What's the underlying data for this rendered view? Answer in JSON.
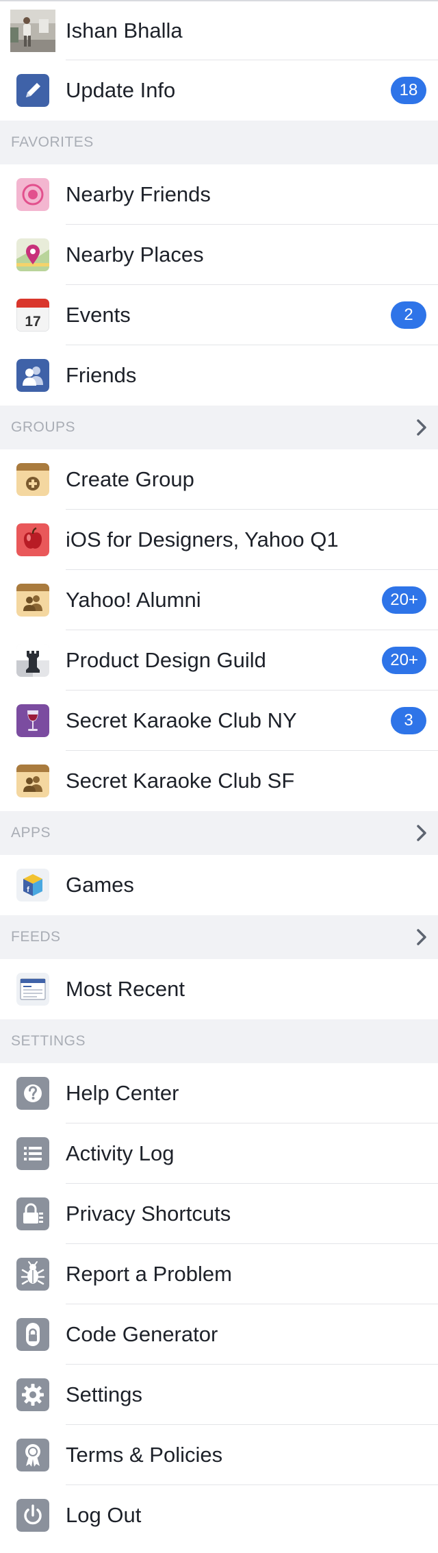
{
  "profile": {
    "name": "Ishan Bhalla"
  },
  "top_items": [
    {
      "id": "update-info",
      "label": "Update Info",
      "badge": "18",
      "icon": "pencil-icon"
    }
  ],
  "sections": {
    "favorites": {
      "title": "FAVORITES",
      "items": [
        {
          "id": "nearby-friends",
          "label": "Nearby Friends",
          "icon": "nearby-friends-icon"
        },
        {
          "id": "nearby-places",
          "label": "Nearby Places",
          "icon": "map-pin-icon"
        },
        {
          "id": "events",
          "label": "Events",
          "badge": "2",
          "icon": "calendar-icon",
          "icon_text": "17"
        },
        {
          "id": "friends",
          "label": "Friends",
          "icon": "friends-icon"
        }
      ]
    },
    "groups": {
      "title": "GROUPS",
      "items": [
        {
          "id": "create-group",
          "label": "Create Group",
          "icon": "create-group-icon"
        },
        {
          "id": "ios-for-designers",
          "label": "iOS for Designers, Yahoo Q1",
          "icon": "apple-icon"
        },
        {
          "id": "yahoo-alumni",
          "label": "Yahoo! Alumni",
          "badge": "20+",
          "icon": "group-icon"
        },
        {
          "id": "product-design-guild",
          "label": "Product Design Guild",
          "badge": "20+",
          "icon": "chess-rook-icon"
        },
        {
          "id": "secret-karaoke-ny",
          "label": "Secret Karaoke Club NY",
          "badge": "3",
          "icon": "wine-glass-icon"
        },
        {
          "id": "secret-karaoke-sf",
          "label": "Secret Karaoke Club SF",
          "icon": "group-icon"
        }
      ]
    },
    "apps": {
      "title": "APPS",
      "items": [
        {
          "id": "games",
          "label": "Games",
          "icon": "games-cube-icon"
        }
      ]
    },
    "feeds": {
      "title": "FEEDS",
      "items": [
        {
          "id": "most-recent",
          "label": "Most Recent",
          "icon": "news-feed-icon"
        }
      ]
    },
    "settings": {
      "title": "SETTINGS",
      "items": [
        {
          "id": "help-center",
          "label": "Help Center",
          "icon": "question-icon"
        },
        {
          "id": "activity-log",
          "label": "Activity Log",
          "icon": "list-icon"
        },
        {
          "id": "privacy-shortcuts",
          "label": "Privacy Shortcuts",
          "icon": "lock-icon"
        },
        {
          "id": "report-problem",
          "label": "Report a Problem",
          "icon": "bug-icon"
        },
        {
          "id": "code-generator",
          "label": "Code Generator",
          "icon": "code-generator-icon"
        },
        {
          "id": "settings",
          "label": "Settings",
          "icon": "gear-icon"
        },
        {
          "id": "terms-policies",
          "label": "Terms & Policies",
          "icon": "ribbon-icon"
        },
        {
          "id": "log-out",
          "label": "Log Out",
          "icon": "power-icon"
        }
      ]
    }
  },
  "colors": {
    "badge": "#2e74e8",
    "section_bg": "#f1f2f5",
    "section_text": "#a9adb5",
    "divider": "#e3e4e8",
    "facebook_blue": "#3b5998",
    "settings_gray": "#8b919c"
  }
}
